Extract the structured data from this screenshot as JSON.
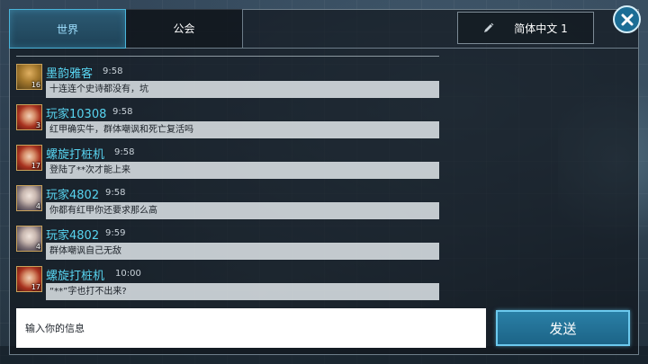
{
  "tabs": [
    {
      "label": "世界",
      "active": true
    },
    {
      "label": "公会",
      "active": false
    }
  ],
  "language_button": {
    "label": "简体中文 1",
    "icon": "pencil-icon"
  },
  "close_button": {
    "icon": "close-icon"
  },
  "messages": [
    {
      "name": "墨韵雅客",
      "time": "9:58",
      "level": "16",
      "text": "十连连个史诗都没有，坑",
      "avatar": "gold-hero"
    },
    {
      "name": "玩家10308",
      "time": "9:58",
      "level": "3",
      "text": "红甲确实牛，群体嘲讽和死亡复活吗",
      "avatar": "red-hair-hero"
    },
    {
      "name": "螺旋打桩机",
      "time": "9:58",
      "level": "17",
      "text": "登陆了**次才能上来",
      "avatar": "red-hair-hero"
    },
    {
      "name": "玩家4802",
      "time": "9:58",
      "level": "4",
      "text": "你都有红甲你还要求那么高",
      "avatar": "silver-hero"
    },
    {
      "name": "玩家4802",
      "time": "9:59",
      "level": "4",
      "text": "群体嘲讽自己无敌",
      "avatar": "silver-hero"
    },
    {
      "name": "螺旋打桩机",
      "time": "10:00",
      "level": "17",
      "text": "“**”字也打不出来?",
      "avatar": "red-hair-hero"
    }
  ],
  "input": {
    "placeholder": "输入你的信息"
  },
  "send_button": {
    "label": "发送"
  },
  "colors": {
    "accent": "#58d4f0",
    "active_tab": "#2c5a73",
    "send_button": "#1c6487"
  }
}
